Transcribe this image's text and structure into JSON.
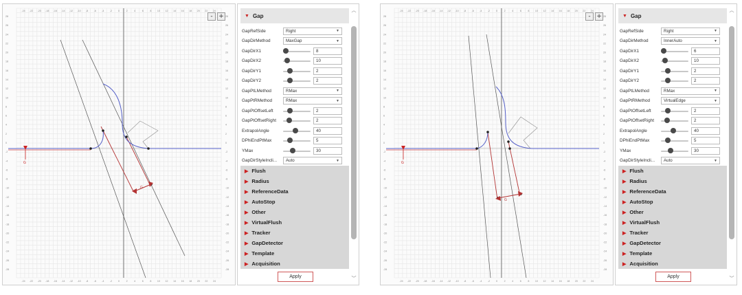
{
  "zoom": {
    "minus": "-",
    "plus": "+"
  },
  "axis": {
    "x_ticks": [
      "-24",
      "-22",
      "-20",
      "-18",
      "-16",
      "-14",
      "-12",
      "-10",
      "-8",
      "-6",
      "-4",
      "-2",
      "0",
      "2",
      "4",
      "6",
      "8",
      "10",
      "12",
      "14",
      "16",
      "18",
      "20",
      "22",
      "24"
    ],
    "y_ticks": [
      "28",
      "26",
      "24",
      "22",
      "20",
      "18",
      "16",
      "14",
      "12",
      "10",
      "8",
      "6",
      "4",
      "2",
      "0",
      "-2",
      "-4",
      "-6",
      "-8",
      "-10",
      "-12",
      "-14",
      "-16",
      "-18",
      "-20",
      "-22",
      "-24",
      "-26",
      "-28"
    ]
  },
  "annotations": {
    "gap_marker": "G",
    "dist_label": "G"
  },
  "apply_label": "Apply",
  "section_headers": [
    "Flush",
    "Radius",
    "ReferenceData",
    "AutoStop",
    "Other",
    "VirtualFlush",
    "Tracker",
    "GapDetector",
    "Template",
    "Acquisition"
  ],
  "left": {
    "gap_header": "Gap",
    "rows": [
      {
        "label": "GapRefSide",
        "type": "dropdown",
        "value": "Right"
      },
      {
        "label": "GapDirMethod",
        "type": "dropdown",
        "value": "MaxGap"
      },
      {
        "label": "GapDirX1",
        "type": "slider",
        "value": "8",
        "level": 0.0
      },
      {
        "label": "GapDirX2",
        "type": "slider",
        "value": "10",
        "level": 0.05
      },
      {
        "label": "GapDirY1",
        "type": "slider",
        "value": "2",
        "level": 0.2
      },
      {
        "label": "GapDirY2",
        "type": "slider",
        "value": "2",
        "level": 0.2
      },
      {
        "label": "GapPtLMethod",
        "type": "dropdown",
        "value": "RMax"
      },
      {
        "label": "GapPtRMethod",
        "type": "dropdown",
        "value": "RMax"
      },
      {
        "label": "GapPtOffsetLeft",
        "type": "slider",
        "value": "2",
        "level": 0.2
      },
      {
        "label": "GapPtOffsetRight",
        "type": "slider",
        "value": "2",
        "level": 0.15
      },
      {
        "label": "ExtrapolAngle",
        "type": "slider",
        "value": "40",
        "level": 0.45
      },
      {
        "label": "DPhiEndPtMax",
        "type": "slider",
        "value": "5",
        "level": 0.2
      },
      {
        "label": "YMax",
        "type": "slider",
        "value": "30",
        "level": 0.3
      },
      {
        "label": "GapDirStyleIncli...",
        "type": "dropdown",
        "value": "Auto"
      }
    ]
  },
  "right": {
    "gap_header": "Gap",
    "rows": [
      {
        "label": "GapRefSide",
        "type": "dropdown",
        "value": "Right"
      },
      {
        "label": "GapDirMethod",
        "type": "dropdown",
        "value": "InnerAuto"
      },
      {
        "label": "GapDirX1",
        "type": "slider",
        "value": "6",
        "level": 0.0
      },
      {
        "label": "GapDirX2",
        "type": "slider",
        "value": "10",
        "level": 0.05
      },
      {
        "label": "GapDirY1",
        "type": "slider",
        "value": "2",
        "level": 0.2
      },
      {
        "label": "GapDirY2",
        "type": "slider",
        "value": "2",
        "level": 0.2
      },
      {
        "label": "GapPtLMethod",
        "type": "dropdown",
        "value": "RMax"
      },
      {
        "label": "GapPtRMethod",
        "type": "dropdown",
        "value": "VirtualEdge"
      },
      {
        "label": "GapPtOffsetLeft",
        "type": "slider",
        "value": "2",
        "level": 0.2
      },
      {
        "label": "GapPtOffsetRight",
        "type": "slider",
        "value": "2",
        "level": 0.15
      },
      {
        "label": "ExtrapolAngle",
        "type": "slider",
        "value": "40",
        "level": 0.45
      },
      {
        "label": "DPhiEndPtMax",
        "type": "slider",
        "value": "5",
        "level": 0.2
      },
      {
        "label": "YMax",
        "type": "slider",
        "value": "30",
        "level": 0.3
      },
      {
        "label": "GapDirStyleIncli...",
        "type": "dropdown",
        "value": "Auto"
      }
    ]
  },
  "colors": {
    "profile": "#5560c8",
    "gap_line": "#b33333",
    "guide_line": "#555555",
    "accent": "#cc2222"
  }
}
